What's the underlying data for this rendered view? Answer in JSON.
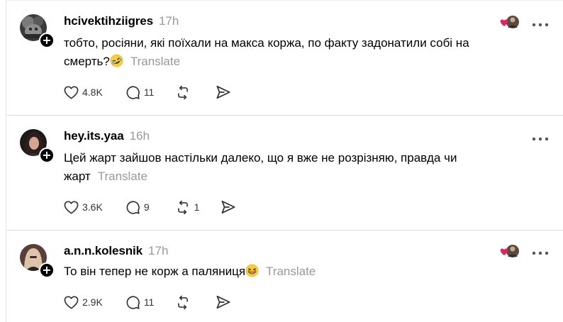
{
  "feed": {
    "translate_label": "Translate",
    "posts": [
      {
        "username": "hcivektihziigres",
        "time": "17h",
        "text": "тобто, росіяни, які поїхали на макса коржа, по факту задонатили собі на смерть?",
        "emoji": "rolling-on-the-floor-laughing-emoji",
        "likes": "4.8K",
        "replies": "11",
        "reposts": "",
        "has_reactors": true
      },
      {
        "username": "hey.its.yaa",
        "time": "16h",
        "text": "Цей жарт зайшов настільки далеко, що я вже не розрізняю, правда чи жарт",
        "emoji": "",
        "likes": "3.6K",
        "replies": "9",
        "reposts": "1",
        "has_reactors": false
      },
      {
        "username": "a.n.n.kolesnik",
        "time": "17h",
        "text": "То він тепер не корж а паляниця",
        "emoji": "grinning-squinting-face-emoji",
        "likes": "2.9K",
        "replies": "11",
        "reposts": "",
        "has_reactors": true
      }
    ]
  },
  "icons": {
    "like": "heart-icon",
    "reply": "comment-bubble-icon",
    "repost": "repost-arrows-icon",
    "share": "send-paper-plane-icon",
    "more": "more-dots-icon",
    "follow": "plus-icon"
  },
  "colors": {
    "text": "#000000",
    "muted": "#999999",
    "divider": "#dcdcdc",
    "reaction_heart": "#e0245e"
  }
}
